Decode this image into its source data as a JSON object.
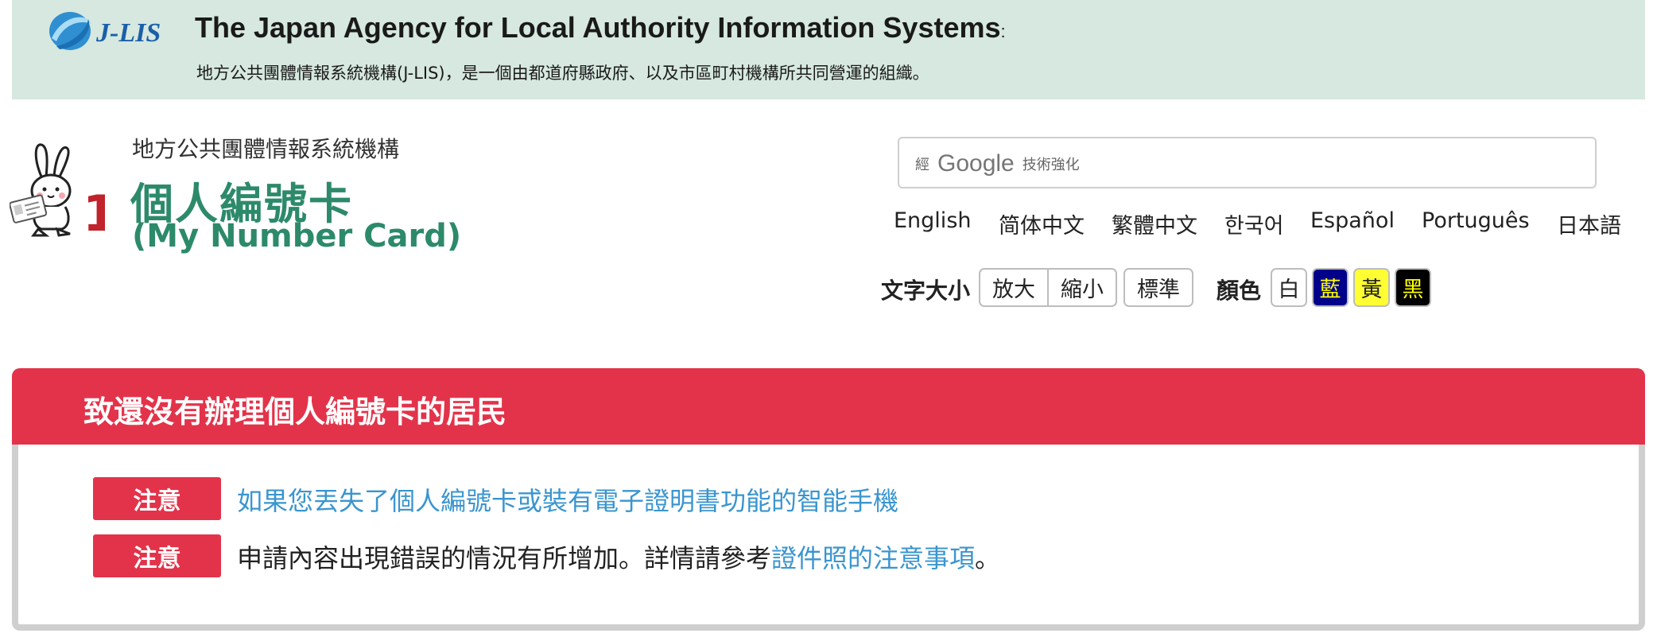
{
  "banner": {
    "logo_text": "J-LIS",
    "title": "The Japan Agency for Local Authority Information Systems",
    "title_suffix": ":",
    "description": "地方公共團體情報系統機構(J-LIS)，是一個由都道府縣政府、以及市區町村機構所共同營運的組織。"
  },
  "site": {
    "org": "地方公共團體情報系統機構",
    "title": "個人編號卡",
    "subtitle": "(My Number Card)",
    "mascot_number": "1"
  },
  "search": {
    "label_small": "經",
    "brand": "Google",
    "powered": "技術強化",
    "placeholder": ""
  },
  "languages": [
    "English",
    "简体中文",
    "繁體中文",
    "한국어",
    "Español",
    "Português",
    "日本語"
  ],
  "text_size": {
    "label": "文字大小",
    "enlarge": "放大",
    "shrink": "縮小",
    "standard": "標準"
  },
  "color": {
    "label": "顏色",
    "options": [
      {
        "label": "白",
        "bg": "#ffffff",
        "fg": "#222222"
      },
      {
        "label": "藍",
        "bg": "#00008b",
        "fg": "#ffff00"
      },
      {
        "label": "黃",
        "bg": "#ffff33",
        "fg": "#222222"
      },
      {
        "label": "黑",
        "bg": "#000000",
        "fg": "#ffff00"
      }
    ]
  },
  "notice": {
    "title": "致還沒有辦理個人編號卡的居民",
    "items": [
      {
        "tag": "注意",
        "link": "如果您丟失了個人編號卡或裝有電子證明書功能的智能手機"
      },
      {
        "tag": "注意",
        "text_before": "申請內容出現錯誤的情況有所增加。詳情請參考",
        "link": "證件照的注意事項",
        "text_after": "。"
      }
    ]
  },
  "colors": {
    "banner_bg": "#d6e8df",
    "brand_green": "#2c8a6a",
    "alert_red": "#e3334a",
    "link_blue": "#3a95cf"
  }
}
